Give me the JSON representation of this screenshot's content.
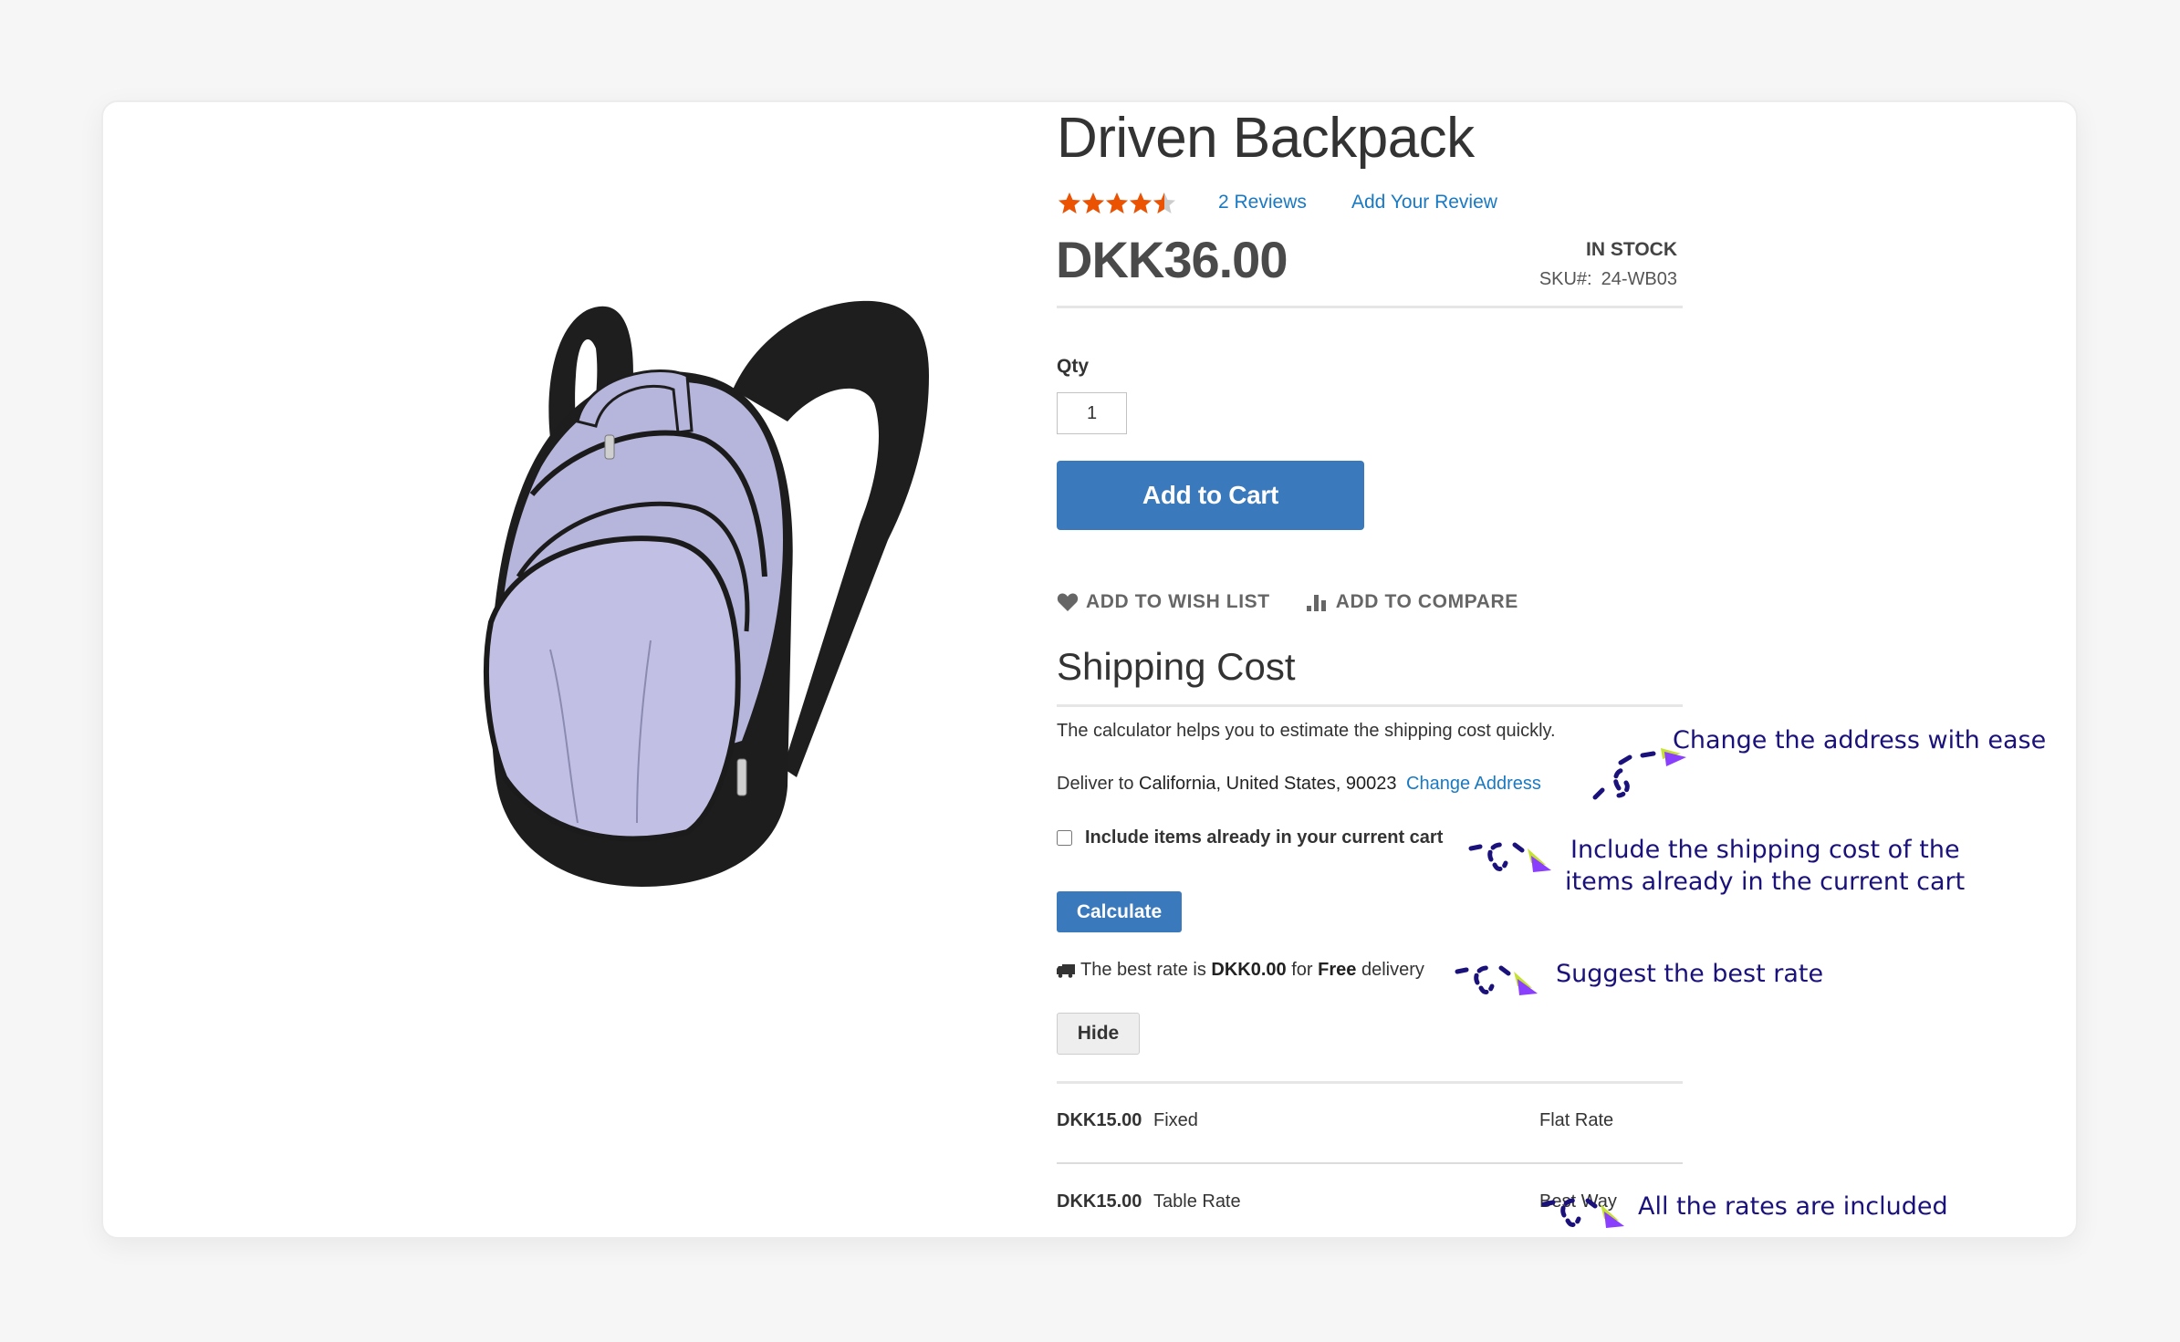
{
  "product": {
    "name": "Driven Backpack",
    "rating": {
      "value": 4.5,
      "max": 5,
      "star_color": "#eb5202",
      "empty_color": "#cccccc"
    },
    "reviews_link": "2  Reviews",
    "add_review_link": "Add Your Review",
    "price": "DKK36.00",
    "stock_status": "IN STOCK",
    "sku_label": "SKU#:",
    "sku_value": "24-WB03",
    "image_alt": "Driven Backpack"
  },
  "purchase": {
    "qty_label": "Qty",
    "qty_value": "1",
    "add_to_cart_label": "Add to Cart",
    "wishlist_label": "ADD TO WISH LIST",
    "compare_label": "ADD TO COMPARE"
  },
  "shipping": {
    "heading": "Shipping Cost",
    "description": "The calculator helps you to estimate the shipping cost quickly.",
    "deliver_prefix": "Deliver to",
    "deliver_location": "California, United States, 90023",
    "change_address_label": "Change Address",
    "include_cart_label": "Include items already in your current cart",
    "include_cart_checked": false,
    "calculate_label": "Calculate",
    "best_rate_prefix": "The best rate is",
    "best_rate_amount": "DKK0.00",
    "best_rate_for": "for",
    "best_rate_method": "Free",
    "best_rate_suffix": "delivery",
    "hide_label": "Hide",
    "rates": [
      {
        "amount": "DKK15.00",
        "carrier": "Fixed",
        "method": "Flat Rate"
      },
      {
        "amount": "DKK15.00",
        "carrier": "Table Rate",
        "method": "Best Way"
      }
    ]
  },
  "annotations": {
    "color": "#1a127a",
    "arrow_accent_purple": "#8a3ffc",
    "arrow_accent_green": "#c5e234",
    "change_address": "Change the address with ease",
    "include_cart_line1": "Include the shipping cost of the",
    "include_cart_line2": "items already in the current cart",
    "best_rate": "Suggest the best rate",
    "all_rates": "All the rates are included"
  },
  "colors": {
    "primary_button": "#3b79bd",
    "link": "#1979c3",
    "page_background": "#f6f6f6"
  }
}
